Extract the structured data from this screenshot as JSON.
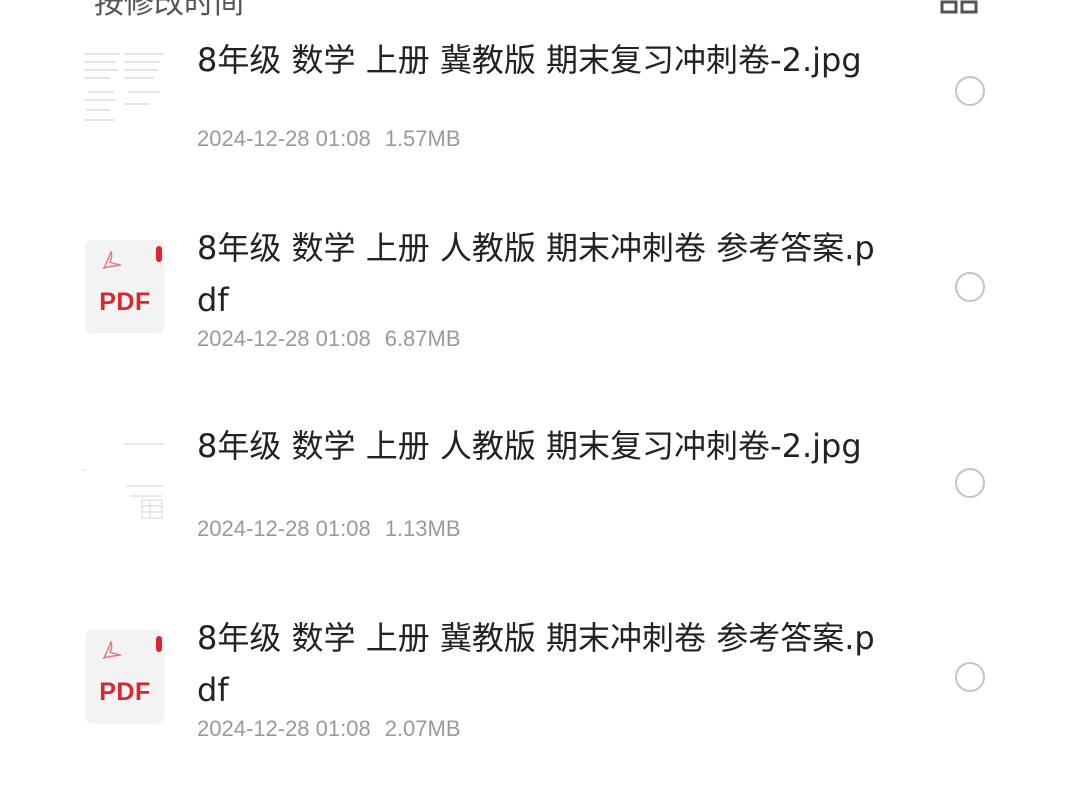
{
  "sort": {
    "label": "按修改时间"
  },
  "files": [
    {
      "name": "8年级 数学 上册 冀教版 期末复习冲刺卷-2.jpg",
      "date": "2024-12-28 01:08",
      "size": "1.57MB",
      "icon": "image-thumbnail"
    },
    {
      "name": "8年级 数学 上册 人教版 期末冲刺卷 参考答案.pdf",
      "date": "2024-12-28 01:08",
      "size": "6.87MB",
      "icon": "pdf-file-icon",
      "icon_label": "PDF"
    },
    {
      "name": "8年级 数学 上册 人教版 期末复习冲刺卷-2.jpg",
      "date": "2024-12-28 01:08",
      "size": "1.13MB",
      "icon": "image-thumbnail"
    },
    {
      "name": "8年级 数学 上册 冀教版 期末冲刺卷 参考答案.pdf",
      "date": "2024-12-28 01:08",
      "size": "2.07MB",
      "icon": "pdf-file-icon",
      "icon_label": "PDF"
    }
  ],
  "colors": {
    "pdf_red": "#d9262f",
    "meta_gray": "#9a9a9a",
    "radio_border": "#c4c4c4"
  }
}
